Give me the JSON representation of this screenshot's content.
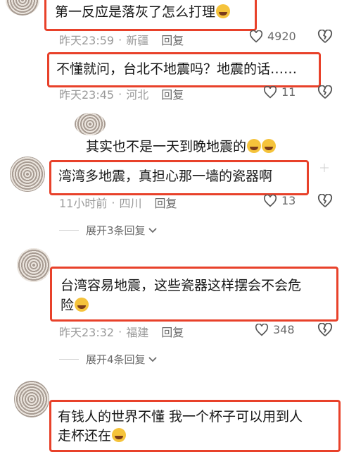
{
  "comments": [
    {
      "text": "第一反应是落灰了怎么打理",
      "emoji": "crying-laugh-emoji",
      "time": "昨天23:59",
      "location": "新疆",
      "reply_label": "回复",
      "likes": "4920"
    },
    {
      "text": "不懂就问，台北不地震吗？地震的话……",
      "time": "昨天23:45",
      "location": "河北",
      "reply_label": "回复",
      "likes": "11"
    },
    {
      "text": "湾湾多地震，真担心那一墙的瓷器啊",
      "time": "11小时前",
      "location": "四川",
      "reply_label": "回复",
      "likes": "13",
      "expand_label": "展开3条回复"
    },
    {
      "text_line1": "台湾容易地震，这些瓷器这样摆会不会危",
      "text_line2": "险",
      "time": "昨天23:32",
      "location": "福建",
      "reply_label": "回复",
      "likes": "348",
      "expand_label": "展开4条回复"
    },
    {
      "text_line1": "有钱人的世界不懂   我一个杯子可以用到人",
      "text_line2": "走杯还在"
    }
  ],
  "reply": {
    "text": "其实也不是一天到晚地震的"
  },
  "separator": "·",
  "colors": {
    "highlight": "#e8412a",
    "meta": "#9a9a9a"
  }
}
